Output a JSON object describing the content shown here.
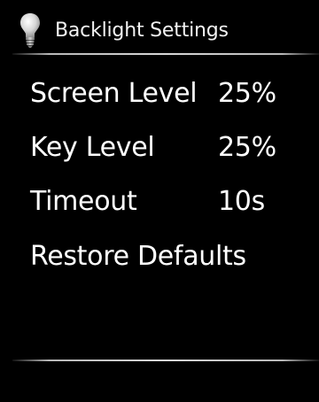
{
  "header": {
    "title": "Backlight Settings",
    "icon": "lightbulb-icon"
  },
  "menu": {
    "items": [
      {
        "label": "Screen Level",
        "value": "25%"
      },
      {
        "label": "Key Level",
        "value": "25%"
      },
      {
        "label": "Timeout",
        "value": "10s"
      },
      {
        "label": "Restore Defaults"
      }
    ]
  },
  "colors": {
    "background": "#000000",
    "text": "#ffffff",
    "divider": "#d8d8d8"
  }
}
